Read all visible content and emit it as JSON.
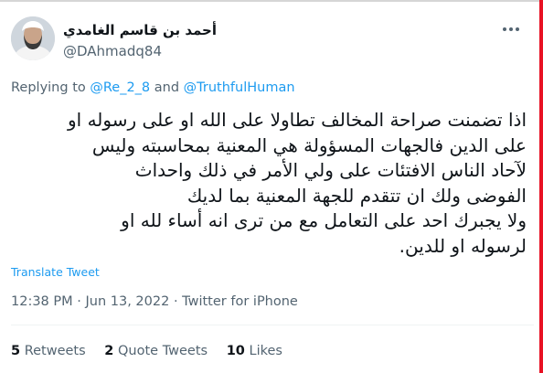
{
  "author": {
    "display_name": "أحمد بن قاسم الغامدي",
    "handle": "@DAhmadq84"
  },
  "reply_context": {
    "prefix": "Replying to",
    "mention_1": "@Re_2_8",
    "conjunction": "and",
    "mention_2": "@TruthfulHuman"
  },
  "tweet": {
    "text": "اذا تضمنت صراحة المخالف تطاولا على الله او على رسوله او\nعلى الدين فالجهات المسؤولة هي المعنية بمحاسبته وليس\nلآحاد الناس الافتئات على ولي الأمر في ذلك واحداث\nالفوضى ولك ان تتقدم للجهة المعنية بما لديك\nولا يجبرك احد على التعامل مع من ترى انه أساء لله او\nلرسوله او للدين.",
    "translate_label": "Translate Tweet"
  },
  "meta": {
    "time": "12:38 PM",
    "separator": "·",
    "date": "Jun 13, 2022",
    "source": "Twitter for iPhone"
  },
  "stats": {
    "retweets_count": "5",
    "retweets_label": "Retweets",
    "quotes_count": "2",
    "quotes_label": "Quote Tweets",
    "likes_count": "10",
    "likes_label": "Likes"
  },
  "icons": {
    "more": "more-horizontal-icon",
    "avatar": "profile-avatar"
  },
  "colors": {
    "link": "#1d9bf0",
    "text": "#0f1419",
    "secondary": "#536471",
    "window_border_accent": "#e81123"
  }
}
